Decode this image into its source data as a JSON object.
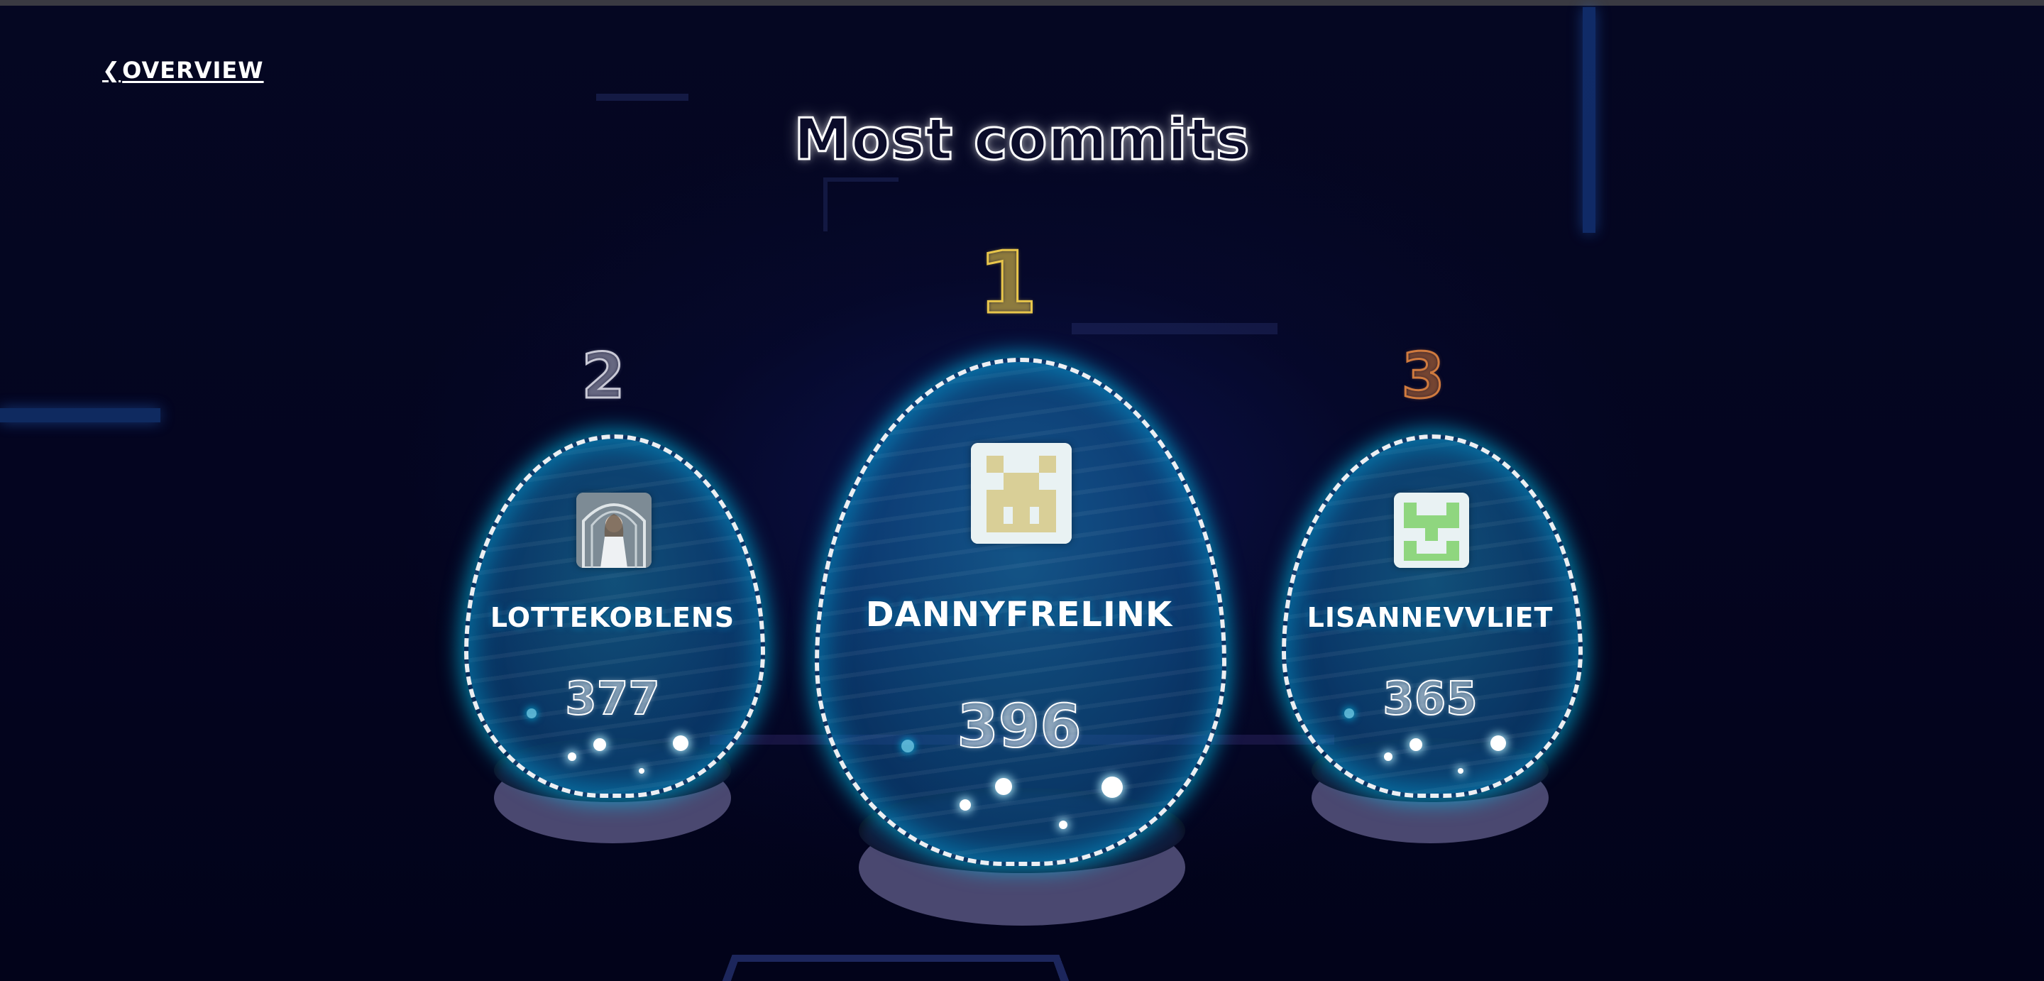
{
  "nav": {
    "back_icon": "chevron-left-icon",
    "back_label": "OVERVIEW"
  },
  "page": {
    "title": "Most commits"
  },
  "leaderboard": {
    "first": {
      "rank": "1",
      "rank_color": "#e8c64b",
      "username": "DANNYFRELINK",
      "commits": "396",
      "avatar_colors": {
        "bg": "#e9f2f3",
        "fg": "#d9cf97"
      }
    },
    "second": {
      "rank": "2",
      "rank_color": "#c9c9d6",
      "username": "LOTTEKOBLENS",
      "commits": "377",
      "avatar_type": "photo"
    },
    "third": {
      "rank": "3",
      "rank_color": "#d07a3e",
      "username": "LISANNEVVLIET",
      "commits": "365",
      "avatar_colors": {
        "bg": "#e9f2f3",
        "fg": "#8fd67f"
      }
    }
  },
  "colors": {
    "background": "#03041a",
    "dome_glow": "#00d2ff",
    "pedestal": "#4a4870"
  }
}
